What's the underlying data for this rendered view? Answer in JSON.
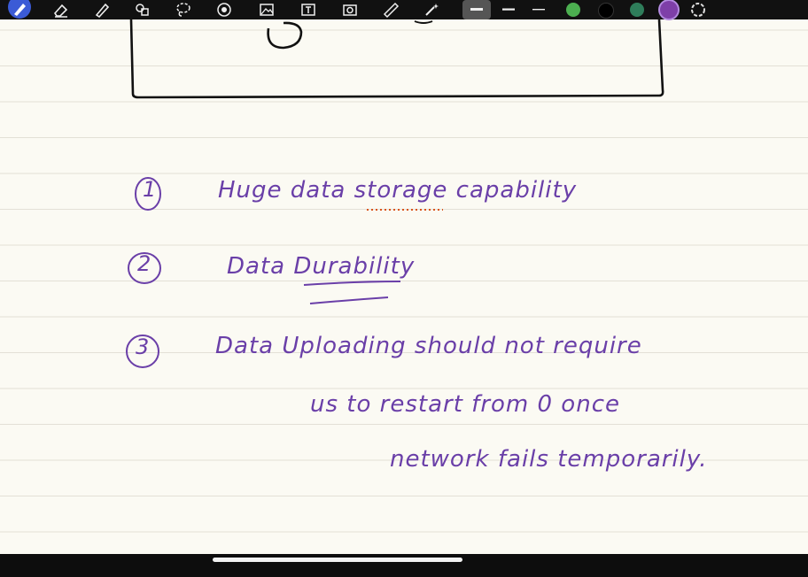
{
  "toolbar": {
    "tools": [
      {
        "icon": "pen-icon",
        "active": true
      },
      {
        "icon": "eraser-icon"
      },
      {
        "icon": "highlighter-icon"
      },
      {
        "icon": "shapes-icon"
      },
      {
        "icon": "lasso-icon"
      },
      {
        "icon": "laser-pointer-icon"
      },
      {
        "icon": "image-icon"
      },
      {
        "icon": "text-icon"
      },
      {
        "icon": "camera-icon"
      },
      {
        "icon": "ruler-icon"
      },
      {
        "icon": "magic-wand-icon"
      }
    ],
    "stroke_widths": [
      "thick",
      "medium",
      "thin"
    ],
    "colors": [
      "#4caf50",
      "#000000",
      "#2e7d5a",
      "#7e3fa8"
    ],
    "selected_color": "#7e3fa8"
  },
  "notes": {
    "item1": {
      "number": "1",
      "text": "Huge data storage capability"
    },
    "item2": {
      "number": "2",
      "text": "Data Durability"
    },
    "item3": {
      "number": "3",
      "line1": "Data Uploading should not require",
      "line2": "us to restart from 0 once",
      "line3": "network fails temporarily."
    }
  },
  "ink_color": "#6a3fa8"
}
